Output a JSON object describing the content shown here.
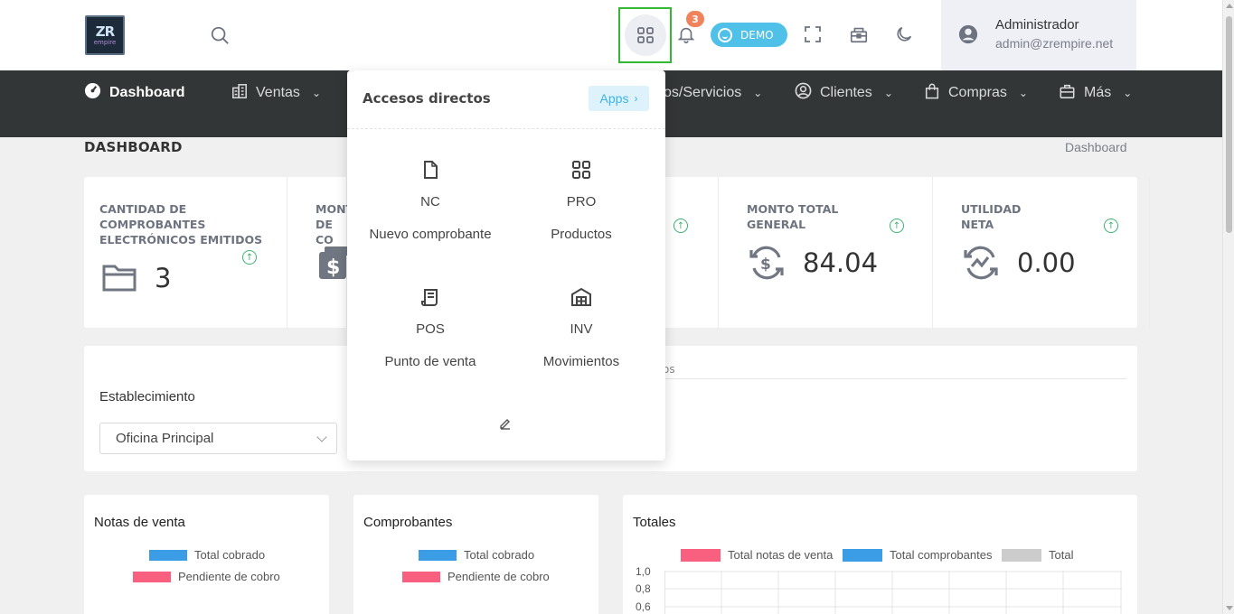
{
  "header": {
    "logo_text": "ZR",
    "logo_subtext": "empire",
    "search_icon": "search-icon",
    "apps_icon": "grid-icon",
    "notifications_count": "3",
    "demo_label": "DEMO",
    "user_name": "Administrador",
    "user_email": "admin@zrempire.net"
  },
  "nav": {
    "items": [
      {
        "label": "Dashboard",
        "icon": "gauge-icon"
      },
      {
        "label": "Ventas",
        "icon": "building-icon"
      },
      {
        "label": "os/Servicios",
        "icon": "box-icon"
      },
      {
        "label": "Clientes",
        "icon": "user-circle-icon"
      },
      {
        "label": "Compras",
        "icon": "bag-icon"
      },
      {
        "label": "Más",
        "icon": "briefcase-icon"
      }
    ]
  },
  "page": {
    "title": "DASHBOARD",
    "breadcrumb": "Dashboard"
  },
  "stats": [
    {
      "label": "CANTIDAD DE COMPROBANTES ELECTRÓNICOS EMITIDOS",
      "value": "3",
      "icon": "folder-icon"
    },
    {
      "label": "MONT DE CO",
      "value": "",
      "icon": "dollar-bill-icon"
    },
    {
      "label": "MONTO TOTAL GENERAL",
      "value": "84.04",
      "icon": "dollar-cycle-icon"
    },
    {
      "label": "UTILIDAD NETA",
      "value": "0.00",
      "icon": "trend-cycle-icon"
    }
  ],
  "filters": {
    "label": "Establecimiento",
    "selected": "Oficina Principal",
    "tab_fragment": "os"
  },
  "charts": {
    "colors": {
      "blue": "#3a9de5",
      "pink": "#f9607f",
      "grey": "#cccccc"
    },
    "cards": [
      {
        "title": "Notas de venta",
        "legend": [
          "Total cobrado",
          "Pendiente de cobro"
        ]
      },
      {
        "title": "Comprobantes",
        "legend": [
          "Total cobrado",
          "Pendiente de cobro"
        ]
      },
      {
        "title": "Totales",
        "legend": [
          "Total notas de venta",
          "Total comprobantes",
          "Total"
        ],
        "y_ticks": [
          "1,0",
          "0,8",
          "0,6"
        ]
      }
    ]
  },
  "dropdown": {
    "title": "Accesos directos",
    "apps_label": "Apps",
    "shortcuts": [
      {
        "code": "NC",
        "name": "Nuevo comprobante",
        "icon": "document-icon"
      },
      {
        "code": "PRO",
        "name": "Productos",
        "icon": "grid-icon"
      },
      {
        "code": "POS",
        "name": "Punto de venta",
        "icon": "receipt-icon"
      },
      {
        "code": "INV",
        "name": "Movimientos",
        "icon": "warehouse-icon"
      }
    ],
    "edit_icon": "pencil-icon"
  }
}
